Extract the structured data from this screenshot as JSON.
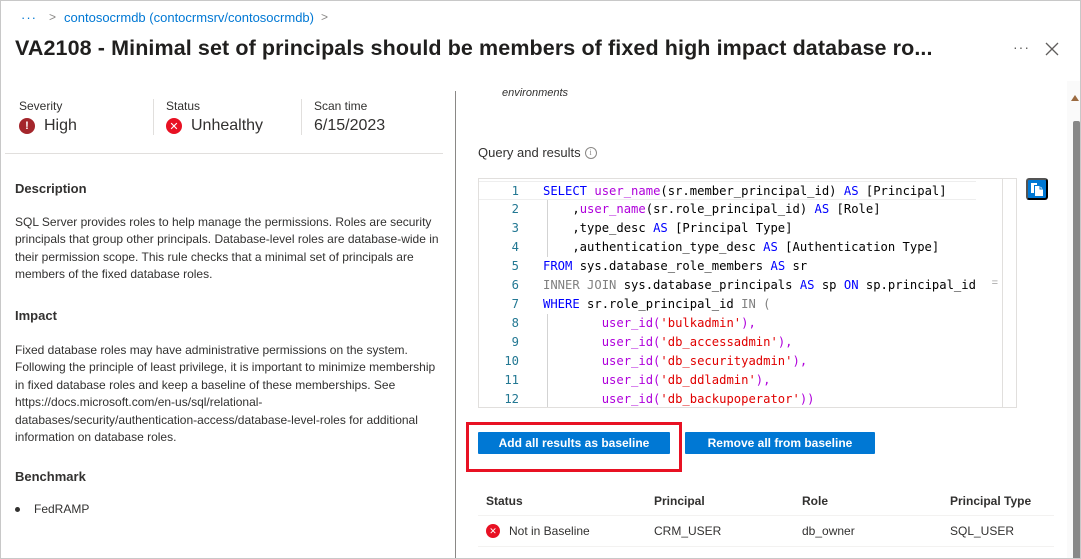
{
  "breadcrumb": {
    "overflow_label": "···",
    "items": [
      {
        "label": "contosocrmdb (contocrmsrv/contosocrmdb)"
      }
    ],
    "separator": ">"
  },
  "header": {
    "title": "VA2108 - Minimal set of principals should be members of fixed high impact database ro...",
    "more_label": "···",
    "close_icon": "close-icon"
  },
  "summary": {
    "severity": {
      "label": "Severity",
      "value": "High",
      "icon": "error-badge-icon",
      "color": "#a4262c"
    },
    "status": {
      "label": "Status",
      "value": "Unhealthy",
      "icon": "error-circle-icon",
      "color": "#e81123"
    },
    "scan_time": {
      "label": "Scan time",
      "value": "6/15/2023"
    }
  },
  "description": {
    "heading": "Description",
    "text": "SQL Server provides roles to help manage the permissions. Roles are security principals that group other principals. Database-level roles are database-wide in their permission scope. This rule checks that a minimal set of principals are members of the fixed database roles."
  },
  "impact": {
    "heading": "Impact",
    "text": "Fixed database roles may have administrative permissions on the system. Following the principle of least privilege, it is important to minimize membership in fixed database roles and keep a baseline of these memberships. See https://docs.microsoft.com/en-us/sql/relational-databases/security/authentication-access/database-level-roles for additional information on database roles."
  },
  "benchmark": {
    "heading": "Benchmark",
    "items": [
      "FedRAMP"
    ]
  },
  "right_panel": {
    "truncated_text": "environments",
    "query_title": "Query and results",
    "query_info_icon": "info-icon",
    "copy_icon": "copy-icon",
    "code_lines": [
      {
        "n": "1",
        "segments": [
          {
            "t": "SELECT ",
            "c": "kw"
          },
          {
            "t": "user_name",
            "c": "fn"
          },
          {
            "t": "(sr.member_principal_id) ",
            "c": "tx"
          },
          {
            "t": "AS",
            "c": "kw"
          },
          {
            "t": " [Principal]",
            "c": "tx"
          }
        ]
      },
      {
        "n": "2",
        "segments": [
          {
            "t": "    ,",
            "c": "tx"
          },
          {
            "t": "user_name",
            "c": "fn"
          },
          {
            "t": "(sr.role_principal_id) ",
            "c": "tx"
          },
          {
            "t": "AS",
            "c": "kw"
          },
          {
            "t": " [Role]",
            "c": "tx"
          }
        ]
      },
      {
        "n": "3",
        "segments": [
          {
            "t": "    ,type_desc ",
            "c": "tx"
          },
          {
            "t": "AS",
            "c": "kw"
          },
          {
            "t": " [Principal Type]",
            "c": "tx"
          }
        ]
      },
      {
        "n": "4",
        "segments": [
          {
            "t": "    ,authentication_type_desc ",
            "c": "tx"
          },
          {
            "t": "AS",
            "c": "kw"
          },
          {
            "t": " [Authentication Type]",
            "c": "tx"
          }
        ]
      },
      {
        "n": "5",
        "segments": [
          {
            "t": "FROM",
            "c": "kw"
          },
          {
            "t": " sys.database_role_members ",
            "c": "tx"
          },
          {
            "t": "AS",
            "c": "kw"
          },
          {
            "t": " sr",
            "c": "tx"
          }
        ]
      },
      {
        "n": "6",
        "segments": [
          {
            "t": "INNER JOIN",
            "c": "gr"
          },
          {
            "t": " sys.database_principals ",
            "c": "tx"
          },
          {
            "t": "AS",
            "c": "kw"
          },
          {
            "t": " sp ",
            "c": "tx"
          },
          {
            "t": "ON",
            "c": "kw"
          },
          {
            "t": " sp.principal_id",
            "c": "tx"
          }
        ]
      },
      {
        "n": "7",
        "segments": [
          {
            "t": "WHERE",
            "c": "kw"
          },
          {
            "t": " sr.role_principal_id ",
            "c": "tx"
          },
          {
            "t": "IN (",
            "c": "gr"
          }
        ]
      },
      {
        "n": "8",
        "segments": [
          {
            "t": "        user_id(",
            "c": "fn"
          },
          {
            "t": "'bulkadmin'",
            "c": "str"
          },
          {
            "t": "),",
            "c": "fn"
          }
        ]
      },
      {
        "n": "9",
        "segments": [
          {
            "t": "        user_id(",
            "c": "fn"
          },
          {
            "t": "'db_accessadmin'",
            "c": "str"
          },
          {
            "t": "),",
            "c": "fn"
          }
        ]
      },
      {
        "n": "10",
        "segments": [
          {
            "t": "        user_id(",
            "c": "fn"
          },
          {
            "t": "'db_securityadmin'",
            "c": "str"
          },
          {
            "t": "),",
            "c": "fn"
          }
        ]
      },
      {
        "n": "11",
        "segments": [
          {
            "t": "        user_id(",
            "c": "fn"
          },
          {
            "t": "'db_ddladmin'",
            "c": "str"
          },
          {
            "t": "),",
            "c": "fn"
          }
        ]
      },
      {
        "n": "12",
        "segments": [
          {
            "t": "        user_id(",
            "c": "fn"
          },
          {
            "t": "'db_backupoperator'",
            "c": "str"
          },
          {
            "t": "))",
            "c": "fn"
          }
        ]
      }
    ],
    "overflow_marker": "=",
    "buttons": {
      "add_baseline": "Add all results as baseline",
      "remove_baseline": "Remove all from baseline"
    },
    "results_table": {
      "columns": [
        "Status",
        "Principal",
        "Role",
        "Principal Type"
      ],
      "rows": [
        {
          "status": "Not in Baseline",
          "status_icon": "error-circle-icon",
          "principal": "CRM_USER",
          "role": "db_owner",
          "principal_type": "SQL_USER"
        }
      ]
    }
  },
  "colors": {
    "accent": "#0078d4",
    "highlight_box": "#e81123",
    "error": "#e81123",
    "severity_high": "#a4262c"
  }
}
